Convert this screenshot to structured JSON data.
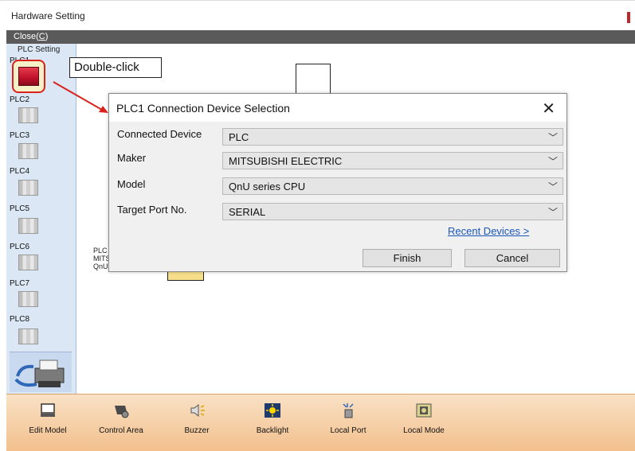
{
  "window": {
    "title": "Hardware Setting"
  },
  "menu": {
    "close_label": "Close(",
    "close_key": "C",
    "close_end": ")"
  },
  "left_panel": {
    "header": "PLC Setting",
    "items": [
      {
        "label": "PLC1"
      },
      {
        "label": "PLC2"
      },
      {
        "label": "PLC3"
      },
      {
        "label": "PLC4"
      },
      {
        "label": "PLC5"
      },
      {
        "label": "PLC6"
      },
      {
        "label": "PLC7"
      },
      {
        "label": "PLC8"
      }
    ]
  },
  "callout": {
    "text": "Double-click"
  },
  "background_fragment": {
    "line1": "PLC",
    "line2": "MITS",
    "line3": "QnU series CPU"
  },
  "dialog": {
    "title": "PLC1 Connection Device Selection",
    "close_glyph": "✕",
    "fields": [
      {
        "label": "Connected Device",
        "value": "PLC"
      },
      {
        "label": "Maker",
        "value": "MITSUBISHI ELECTRIC"
      },
      {
        "label": "Model",
        "value": "QnU series CPU"
      },
      {
        "label": "Target Port No.",
        "value": "SERIAL"
      }
    ],
    "recent_link": "Recent Devices >",
    "finish_button": "Finish",
    "cancel_button": "Cancel"
  },
  "toolbar": {
    "items": [
      {
        "label": "Edit Model",
        "icon": "monitor-icon"
      },
      {
        "label": "Control Area",
        "icon": "gear-device-icon"
      },
      {
        "label": "Buzzer",
        "icon": "speaker-icon"
      },
      {
        "label": "Backlight",
        "icon": "sun-icon"
      },
      {
        "label": "Local Port",
        "icon": "port-icon"
      },
      {
        "label": "Local Mode",
        "icon": "mode-icon"
      }
    ]
  },
  "colors": {
    "accent_red": "#d9221b",
    "link_blue": "#1a56b8",
    "panel_blue": "#dbe7f5",
    "toolbar_orange": "#f2c08d"
  }
}
